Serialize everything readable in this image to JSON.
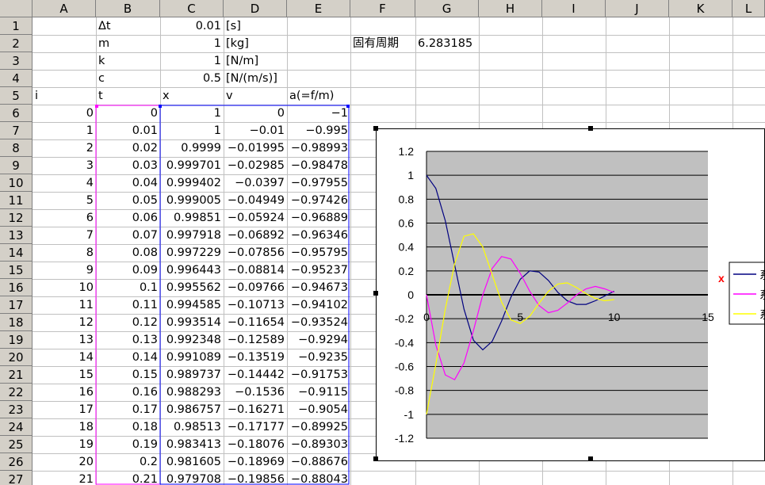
{
  "columns": [
    "A",
    "B",
    "C",
    "D",
    "E",
    "F",
    "G",
    "H",
    "I",
    "J",
    "K",
    "L"
  ],
  "row_numbers": [
    1,
    2,
    3,
    4,
    5,
    6,
    7,
    8,
    9,
    10,
    11,
    12,
    13,
    14,
    15,
    16,
    17,
    18,
    19,
    20,
    21,
    22,
    23,
    24,
    25,
    26,
    27
  ],
  "params": [
    {
      "name": "Δt",
      "value": "0.01",
      "unit": "[s]"
    },
    {
      "name": "m",
      "value": "1",
      "unit": "[kg]"
    },
    {
      "name": "k",
      "value": "1",
      "unit": "[N/m]"
    },
    {
      "name": "c",
      "value": "0.5",
      "unit": "[N/(m/s)]"
    }
  ],
  "natural_period": {
    "label": "固有周期",
    "value": "6.283185"
  },
  "headers": {
    "i": "i",
    "t": "t",
    "x": "x",
    "v": "v",
    "a": "a(=f/m)"
  },
  "table": [
    [
      "0",
      "0",
      "1",
      "0",
      "−1"
    ],
    [
      "1",
      "0.01",
      "1",
      "−0.01",
      "−0.995"
    ],
    [
      "2",
      "0.02",
      "0.9999",
      "−0.01995",
      "−0.98993"
    ],
    [
      "3",
      "0.03",
      "0.999701",
      "−0.02985",
      "−0.98478"
    ],
    [
      "4",
      "0.04",
      "0.999402",
      "−0.0397",
      "−0.97955"
    ],
    [
      "5",
      "0.05",
      "0.999005",
      "−0.04949",
      "−0.97426"
    ],
    [
      "6",
      "0.06",
      "0.99851",
      "−0.05924",
      "−0.96889"
    ],
    [
      "7",
      "0.07",
      "0.997918",
      "−0.06892",
      "−0.96346"
    ],
    [
      "8",
      "0.08",
      "0.997229",
      "−0.07856",
      "−0.95795"
    ],
    [
      "9",
      "0.09",
      "0.996443",
      "−0.08814",
      "−0.95237"
    ],
    [
      "10",
      "0.1",
      "0.995562",
      "−0.09766",
      "−0.94673"
    ],
    [
      "11",
      "0.11",
      "0.994585",
      "−0.10713",
      "−0.94102"
    ],
    [
      "12",
      "0.12",
      "0.993514",
      "−0.11654",
      "−0.93524"
    ],
    [
      "13",
      "0.13",
      "0.992348",
      "−0.12589",
      "−0.9294"
    ],
    [
      "14",
      "0.14",
      "0.991089",
      "−0.13519",
      "−0.9235"
    ],
    [
      "15",
      "0.15",
      "0.989737",
      "−0.14442",
      "−0.91753"
    ],
    [
      "16",
      "0.16",
      "0.988293",
      "−0.1536",
      "−0.9115"
    ],
    [
      "17",
      "0.17",
      "0.986757",
      "−0.16271",
      "−0.9054"
    ],
    [
      "18",
      "0.18",
      "0.98513",
      "−0.17177",
      "−0.89925"
    ],
    [
      "19",
      "0.19",
      "0.983413",
      "−0.18076",
      "−0.89303"
    ],
    [
      "20",
      "0.2",
      "0.981605",
      "−0.18969",
      "−0.88676"
    ],
    [
      "21",
      "0.21",
      "0.979708",
      "−0.19856",
      "−0.88043"
    ]
  ],
  "colors": {
    "x_series": "#000080",
    "v_series": "#ff00ff",
    "a_series": "#ffff00",
    "plot_bg": "#c0c0c0",
    "selection": "#0000ff"
  },
  "chart_data": {
    "type": "line",
    "title": "",
    "xlabel": "",
    "ylabel": "",
    "xlim": [
      0,
      15
    ],
    "ylim": [
      -1.2,
      1.2
    ],
    "x_ticks": [
      "0",
      "5",
      "10",
      "15"
    ],
    "y_ticks": [
      "1.2",
      "1",
      "0.8",
      "0.6",
      "0.4",
      "0.2",
      "0",
      "-0.2",
      "-0.4",
      "-0.6",
      "-0.8",
      "-1",
      "-1.2"
    ],
    "grid": "horizontal",
    "legend": "right",
    "legend_entries": [
      "系",
      "系",
      "系"
    ],
    "legend_marker": "x",
    "x": [
      0,
      0.5,
      1,
      1.5,
      2,
      2.5,
      3,
      3.5,
      4,
      4.5,
      5,
      5.5,
      6,
      6.5,
      7,
      7.5,
      8,
      8.5,
      9,
      9.5,
      10
    ],
    "series": [
      {
        "color": "#000080",
        "values": [
          1,
          0.89,
          0.62,
          0.25,
          -0.12,
          -0.38,
          -0.46,
          -0.39,
          -0.22,
          -0.02,
          0.13,
          0.2,
          0.19,
          0.12,
          0.02,
          -0.05,
          -0.08,
          -0.08,
          -0.05,
          -0.01,
          0.03
        ]
      },
      {
        "color": "#ff00ff",
        "values": [
          0,
          -0.42,
          -0.67,
          -0.71,
          -0.57,
          -0.3,
          0.0,
          0.22,
          0.32,
          0.3,
          0.18,
          0.03,
          -0.09,
          -0.15,
          -0.13,
          -0.07,
          0.0,
          0.05,
          0.07,
          0.05,
          0.02
        ]
      },
      {
        "color": "#ffff00",
        "values": [
          -1,
          -0.58,
          -0.12,
          0.26,
          0.49,
          0.51,
          0.4,
          0.17,
          -0.06,
          -0.21,
          -0.24,
          -0.18,
          -0.07,
          0.03,
          0.09,
          0.1,
          0.06,
          0.01,
          -0.03,
          -0.05,
          -0.04
        ]
      }
    ]
  }
}
